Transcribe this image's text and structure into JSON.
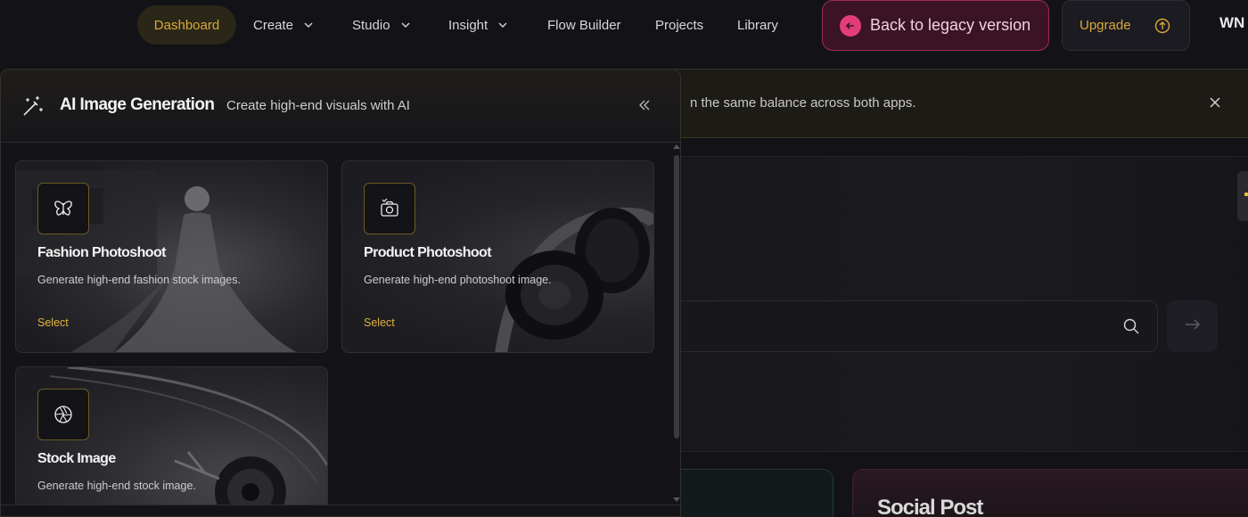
{
  "nav": {
    "items": [
      {
        "label": "Dashboard"
      },
      {
        "label": "Create"
      },
      {
        "label": "Studio"
      },
      {
        "label": "Insight"
      },
      {
        "label": "Flow Builder"
      },
      {
        "label": "Projects"
      },
      {
        "label": "Library"
      }
    ],
    "legacy_label": "Back to legacy version",
    "upgrade_label": "Upgrade",
    "avatar_initials": "WN"
  },
  "banner": {
    "text": "n the same balance across both apps."
  },
  "background": {
    "social_title": "Social Post"
  },
  "panel": {
    "title": "AI Image Generation",
    "subtitle": "Create high-end visuals with AI",
    "cards": [
      {
        "title": "Fashion Photoshoot",
        "description": "Generate high-end fashion stock images.",
        "action": "Select",
        "icon": "butterfly-icon"
      },
      {
        "title": "Product Photoshoot",
        "description": "Generate high-end photoshoot image.",
        "action": "Select",
        "icon": "camera-icon"
      },
      {
        "title": "Stock Image",
        "description": "Generate high-end stock image.",
        "icon": "aperture-icon"
      }
    ]
  },
  "colors": {
    "accent": "#d8a93a",
    "legacy": "#e23d7a",
    "background": "#121217"
  }
}
